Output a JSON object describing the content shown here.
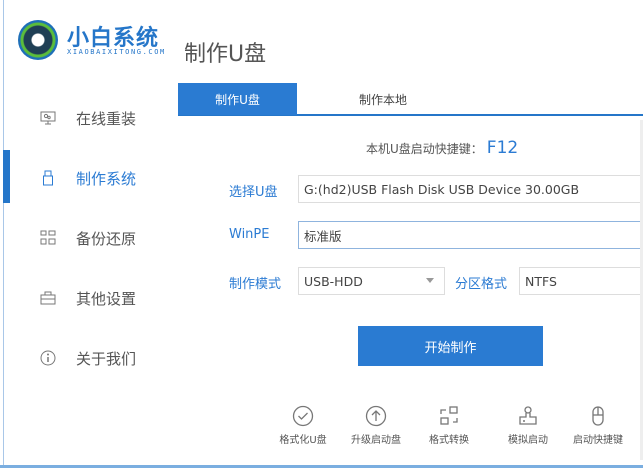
{
  "brand": {
    "name": "小白系统",
    "subtitle": "XIAOBAIXITONG.COM"
  },
  "page_title": "制作U盘",
  "sidebar": {
    "items": [
      {
        "label": "在线重装",
        "icon": "monitor-icon"
      },
      {
        "label": "制作系统",
        "icon": "usb-icon",
        "active": true
      },
      {
        "label": "备份还原",
        "icon": "grid-icon"
      },
      {
        "label": "其他设置",
        "icon": "briefcase-icon"
      },
      {
        "label": "关于我们",
        "icon": "info-icon"
      }
    ]
  },
  "tabs": [
    {
      "label": "制作U盘",
      "active": true
    },
    {
      "label": "制作本地"
    }
  ],
  "hotkey": {
    "label": "本机U盘启动快捷键：",
    "key": "F12"
  },
  "form": {
    "usb_label": "选择U盘",
    "usb_value": "G:(hd2)USB Flash Disk USB Device 30.00GB",
    "winpe_label": "WinPE",
    "winpe_value": "标准版",
    "mode_label": "制作模式",
    "mode_value": "USB-HDD",
    "partition_label": "分区格式",
    "partition_value": "NTFS"
  },
  "start_button": "开始制作",
  "tools": [
    {
      "label": "格式化U盘",
      "icon": "check-circle-icon"
    },
    {
      "label": "升级启动盘",
      "icon": "arrow-up-circle-icon"
    },
    {
      "label": "格式转换",
      "icon": "convert-icon"
    },
    {
      "label": "模拟启动",
      "icon": "stamp-icon"
    },
    {
      "label": "启动快捷键",
      "icon": "mouse-icon"
    }
  ],
  "colors": {
    "accent": "#2a7bd2"
  }
}
